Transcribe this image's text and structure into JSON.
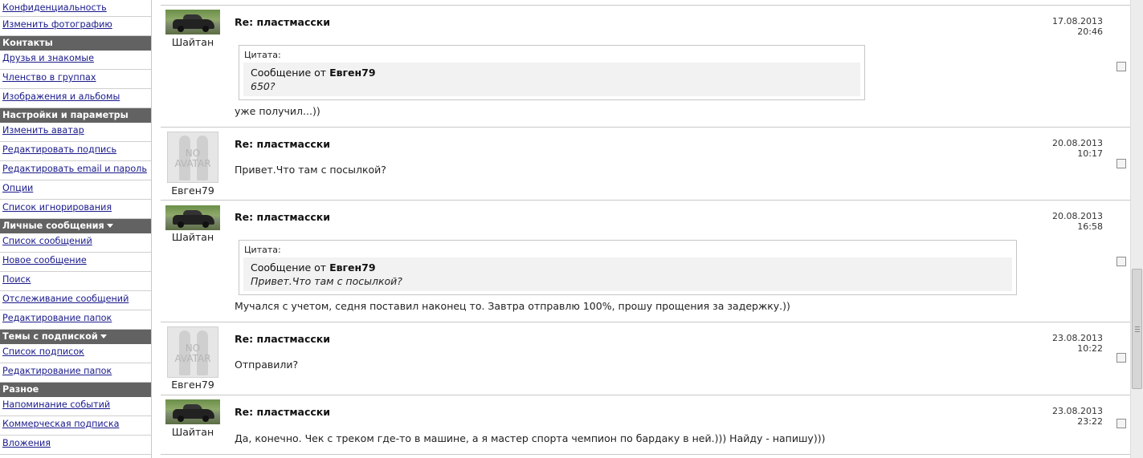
{
  "sidebar": {
    "items": [
      {
        "type": "link",
        "label": "Конфиденциальность"
      },
      {
        "type": "link",
        "label": "Изменить фотографию"
      },
      {
        "type": "header",
        "label": "Контакты"
      },
      {
        "type": "link",
        "label": "Друзья и знакомые"
      },
      {
        "type": "link",
        "label": "Членство в группах"
      },
      {
        "type": "link",
        "label": "Изображения и альбомы"
      },
      {
        "type": "header",
        "label": "Настройки и параметры"
      },
      {
        "type": "link",
        "label": "Изменить аватар"
      },
      {
        "type": "link",
        "label": "Редактировать подпись"
      },
      {
        "type": "link",
        "label": "Редактировать email и пароль"
      },
      {
        "type": "link",
        "label": "Опции"
      },
      {
        "type": "link",
        "label": "Список игнорирования"
      },
      {
        "type": "header",
        "label": "Личные сообщения"
      },
      {
        "type": "link",
        "label": "Список сообщений"
      },
      {
        "type": "link",
        "label": "Новое сообщение"
      },
      {
        "type": "link",
        "label": "Поиск"
      },
      {
        "type": "link",
        "label": "Отслеживание сообщений"
      },
      {
        "type": "link",
        "label": "Редактирование папок"
      },
      {
        "type": "header",
        "label": "Темы с подпиской"
      },
      {
        "type": "link",
        "label": "Список подписок"
      },
      {
        "type": "link",
        "label": "Редактирование папок"
      },
      {
        "type": "header",
        "label": "Разное"
      },
      {
        "type": "link",
        "label": "Напоминание событий"
      },
      {
        "type": "link",
        "label": "Коммерческая подписка"
      },
      {
        "type": "link",
        "label": "Вложения"
      }
    ]
  },
  "posts": [
    {
      "author": "Шайтан",
      "avatar": "car-photo",
      "title": "Re: пластмасски",
      "date": "17.08.2013",
      "time": "20:46",
      "quote": {
        "label": "Цитата:",
        "from_prefix": "Сообщение от",
        "from": "Евген79",
        "text": "650?"
      },
      "body": "уже получил...))"
    },
    {
      "author": "Евген79",
      "avatar": "no-avatar",
      "avatar_text": [
        "NO",
        "AVATAR"
      ],
      "title": "Re: пластмасски",
      "date": "20.08.2013",
      "time": "10:17",
      "body": "Привет.Что там с посылкой?"
    },
    {
      "author": "Шайтан",
      "avatar": "car-photo",
      "title": "Re: пластмасски",
      "date": "20.08.2013",
      "time": "16:58",
      "quote": {
        "label": "Цитата:",
        "from_prefix": "Сообщение от",
        "from": "Евген79",
        "text": "Привет.Что там с посылкой?"
      },
      "body": "Мучался с учетом, седня поставил наконец то. Завтра отправлю 100%, прошу прощения за задержку.))"
    },
    {
      "author": "Евген79",
      "avatar": "no-avatar",
      "avatar_text": [
        "NO",
        "AVATAR"
      ],
      "title": "Re: пластмасски",
      "date": "23.08.2013",
      "time": "10:22",
      "body": "Отправили?"
    },
    {
      "author": "Шайтан",
      "avatar": "car-photo",
      "title": "Re: пластмасски",
      "date": "23.08.2013",
      "time": "23:22",
      "body": "Да, конечно. Чек с треком где-то в машине, а я мастер спорта чемпион по бардаку в ней.))) Найду - напишу)))"
    }
  ],
  "colors": {
    "sidebar_header_bg": "#626262",
    "link": "#1a1a8c",
    "quote_bg": "#f2f2f2",
    "border": "#c8c8c8"
  }
}
